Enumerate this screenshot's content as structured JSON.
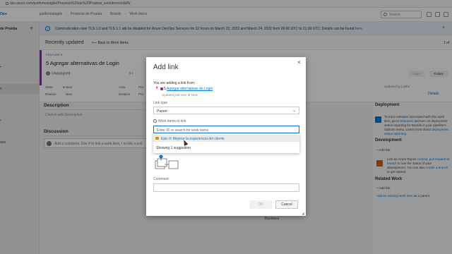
{
  "browser": {
    "url": "dev.azure.com/justfortestagile/Proyecto%20de%20Prueba/_workitems/edit/5/"
  },
  "topbar": {
    "org": "Ops",
    "breadcrumbs": [
      "justfortestagile",
      "Proyecto de Prueba",
      "Boards",
      "Work items"
    ],
    "search_placeholder": "Search"
  },
  "leftnav": {
    "project": "de Prueba",
    "plus": "+",
    "items": [
      "s",
      "ans"
    ]
  },
  "banner": {
    "text": "Communication over TLS 1.0 and TLS 1.1 will be disabled for Azure DevOps Services for 12 hours on March 22, 2022 and March 24, 2022 from 09:00 UTC to 21:00 UTC. Details can be found ",
    "link": "here."
  },
  "subhead": {
    "recent": "Recently updated",
    "back": "Back to Work Items",
    "pager": "1 of"
  },
  "workitem": {
    "type": "FEATURE 5",
    "title": "5  Agregar alternativas de Login",
    "assignee": "Unassigned",
    "comments": "0 c",
    "fields": [
      {
        "label": "State",
        "value": "New"
      },
      {
        "label": "Reason",
        "value": "New"
      },
      {
        "label": "Area",
        "value": "Pro"
      },
      {
        "label": "Iteration",
        "value": "Pro"
      }
    ],
    "save": "Save",
    "follow": "Follow",
    "updated_by": "Updated by justfor",
    "details_tab": "Details"
  },
  "sections": {
    "description": "Description",
    "description_placeholder": "Click to add Description",
    "discussion": "Discussion",
    "comment_placeholder": "Add a comment. Use # to link a work item, ! to link a pull"
  },
  "right": {
    "deployment_title": "Deployment",
    "deployment_text_1": "To track releases associated with this work item, go to",
    "deployment_link": "Releases",
    "deployment_text_2": "and turn on deployment status reporting for Boards in your pipeline's Options menu. Learn more about",
    "deployment_link_2": "deployment status reporting",
    "development_title": "Development",
    "add_link": "+ Add link",
    "dev_text_1": "Link an Azure Repos",
    "dev_link_1": "commit, pull request",
    "dev_text_2": "or",
    "dev_link_2": "branch",
    "dev_text_3": "to see the status of your development. You can also",
    "dev_link_3": "create a branch",
    "dev_text_4": "to get started.",
    "related_title": "Related Work",
    "related_add": "+ Add link",
    "related_text_link": "Add an existing work item",
    "related_text": "as a parent"
  },
  "business": "Business",
  "dialog": {
    "title": "Add link",
    "close": "×",
    "adding_from": "You are adding a link from:",
    "source_link": "Agregar alternativas de Login",
    "source_id": "5",
    "source_meta_time": "Updated just now",
    "source_meta_state": "New",
    "link_type_label": "Link type",
    "link_type_value": "Parent",
    "work_items_label": "Work items to link",
    "work_items_placeholder": "Enter ID or search for work items",
    "suggestion": "Epic 4: Mejorar la experiencia del cliente",
    "suggestion_count": "Showing 1 suggestion",
    "comment_label": "Comment",
    "ok": "OK",
    "cancel": "Cancel"
  }
}
